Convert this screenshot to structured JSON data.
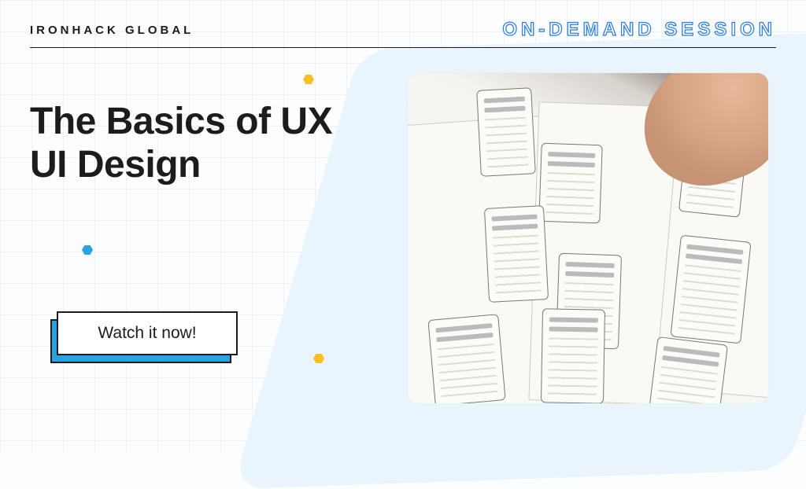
{
  "header": {
    "brand": "IRONHACK GLOBAL",
    "session_label": "ON-DEMAND SESSION"
  },
  "main": {
    "title": "The Basics of UX UI Design"
  },
  "cta": {
    "label": "Watch it now!"
  },
  "image": {
    "alt": "Hand sketching mobile app wireframes on paper with a pen"
  }
}
